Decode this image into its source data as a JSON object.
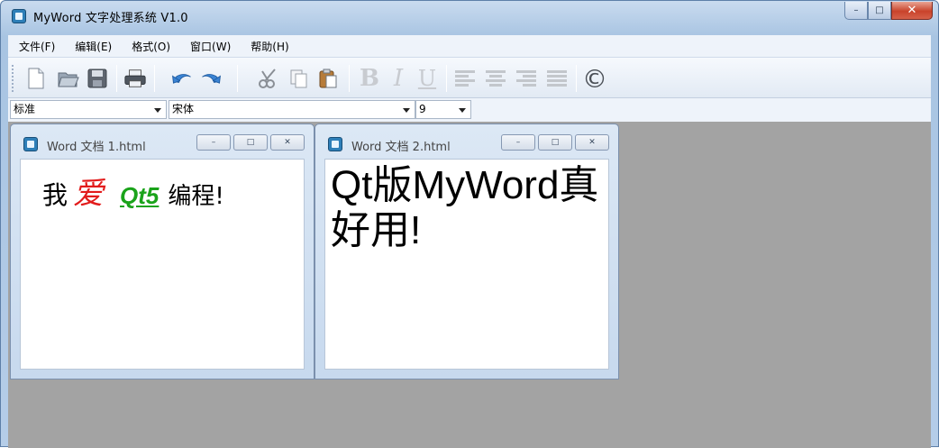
{
  "app": {
    "title": "MyWord 文字处理系统 V1.0",
    "caption": {
      "minimize": "–",
      "maximize": "□",
      "close": "✕"
    }
  },
  "menu": [
    "文件(F)",
    "编辑(E)",
    "格式(O)",
    "窗口(W)",
    "帮助(H)"
  ],
  "toolbar": {
    "icons": [
      "new-icon",
      "open-icon",
      "save-icon",
      "print-icon",
      "undo-icon",
      "redo-icon",
      "cut-icon",
      "copy-icon",
      "paste-icon",
      "bold-icon",
      "italic-icon",
      "underline-icon",
      "align-left-icon",
      "align-center-icon",
      "align-right-icon",
      "justify-icon",
      "about-icon"
    ],
    "bold_glyph": "B",
    "italic_glyph": "I",
    "underline_glyph": "U",
    "about_glyph": "©"
  },
  "format": {
    "style": "标准",
    "font": "宋体",
    "size": "9"
  },
  "documents": [
    {
      "title": "Word 文档 1.html",
      "content": {
        "part1": "我",
        "part2": "爱",
        "part3": "Qt5",
        "part4": "编程!"
      },
      "colors": {
        "part2": "#e21b1b",
        "part3": "#1aa31a"
      }
    },
    {
      "title": "Word 文档 2.html",
      "content": "Qt版MyWord真好用!"
    }
  ],
  "child_caption": {
    "minimize": "–",
    "maximize": "□",
    "close": "✕"
  }
}
